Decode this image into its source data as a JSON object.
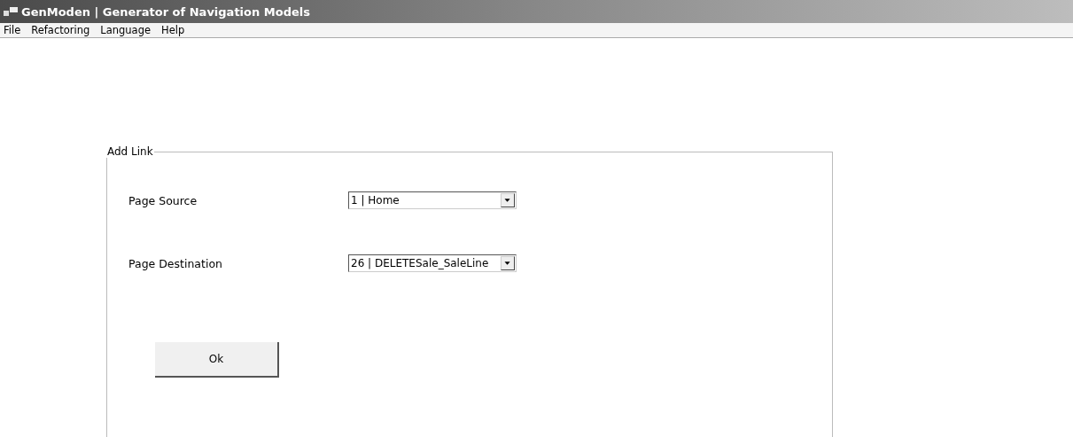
{
  "window": {
    "title": "GenModen | Generator of Navigation Models"
  },
  "menu": [
    "File",
    "Refactoring",
    "Language",
    "Help"
  ],
  "group": {
    "title": "Add Link",
    "fields": [
      {
        "label": "Page Source",
        "value": "1 | Home"
      },
      {
        "label": "Page Destination",
        "value": "26 | DELETESale_SaleLine"
      }
    ],
    "button": "Ok"
  }
}
